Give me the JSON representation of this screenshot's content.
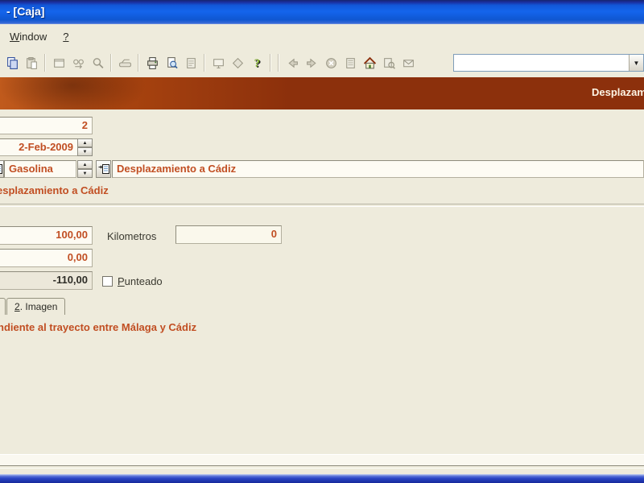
{
  "window": {
    "title": "- [Caja]"
  },
  "menu": {
    "items": [
      {
        "prefix": "W",
        "rest": "indow"
      },
      {
        "prefix": "?",
        "rest": ""
      }
    ]
  },
  "toolbar": {
    "items": [
      {
        "type": "icon",
        "icon": "copy",
        "name": "copy",
        "enabled": true
      },
      {
        "type": "icon",
        "icon": "paste",
        "name": "paste",
        "enabled": false
      },
      {
        "type": "sep"
      },
      {
        "type": "icon",
        "icon": "newwin",
        "name": "new-window",
        "enabled": false
      },
      {
        "type": "icon",
        "icon": "findnext",
        "name": "find-next",
        "enabled": false
      },
      {
        "type": "icon",
        "icon": "zoom",
        "name": "zoom",
        "enabled": false
      },
      {
        "type": "sep"
      },
      {
        "type": "icon",
        "icon": "scanner",
        "name": "scanner",
        "enabled": false
      },
      {
        "type": "sep"
      },
      {
        "type": "icon",
        "icon": "print",
        "name": "print",
        "enabled": true
      },
      {
        "type": "icon",
        "icon": "preview",
        "name": "print-preview",
        "enabled": true
      },
      {
        "type": "icon",
        "icon": "save",
        "name": "save",
        "enabled": false
      },
      {
        "type": "sep"
      },
      {
        "type": "icon",
        "icon": "monitor",
        "name": "monitor",
        "enabled": false
      },
      {
        "type": "icon",
        "icon": "tag",
        "name": "publish",
        "enabled": false
      },
      {
        "type": "icon",
        "icon": "help",
        "name": "help",
        "enabled": true
      },
      {
        "type": "sep"
      },
      {
        "type": "sep"
      },
      {
        "type": "icon",
        "icon": "back",
        "name": "back",
        "enabled": false
      },
      {
        "type": "icon",
        "icon": "forward",
        "name": "forward",
        "enabled": false
      },
      {
        "type": "icon",
        "icon": "stop",
        "name": "stop",
        "enabled": false
      },
      {
        "type": "icon",
        "icon": "refresh",
        "name": "refresh",
        "enabled": false
      },
      {
        "type": "icon",
        "icon": "home",
        "name": "home",
        "enabled": true
      },
      {
        "type": "icon",
        "icon": "search",
        "name": "web-search",
        "enabled": false
      },
      {
        "type": "icon",
        "icon": "mail",
        "name": "mail",
        "enabled": false
      }
    ],
    "address_combo": {
      "value": "",
      "placeholder": ""
    }
  },
  "header": {
    "title_fragment": "Desplazam"
  },
  "form": {
    "numero": {
      "value": "2"
    },
    "fecha": {
      "value": "2-Feb-2009"
    },
    "concepto": {
      "value": "Gasolina"
    },
    "descripcion": {
      "value": "Desplazamiento a Cádiz"
    },
    "descripcion_label_fragment": "esplazamiento a Cádiz",
    "importe": {
      "value": "100,00"
    },
    "importe2": {
      "value": "0,00"
    },
    "saldo": {
      "value": "-110,00"
    },
    "kilometros": {
      "label": "Kilometros",
      "value": "0"
    },
    "punteado": {
      "prefix": "P",
      "rest": "unteado",
      "checked": false
    }
  },
  "tabs": {
    "active": {
      "prefix": "2",
      "rest": ". Imagen"
    }
  },
  "panel": {
    "note_fragment": "ndiente al trayecto entre Málaga y Cádiz"
  },
  "colors": {
    "accent_orange": "#C14E22",
    "band_red": "#8C300C",
    "band_orange_left": "#C05A1C",
    "beige": "#EEEBDC",
    "title_blue": "#1465EC",
    "taskbar_blue": "#2B46C4",
    "field_bg": "#FDFBF3",
    "readonly_bg": "#ECE8DA"
  }
}
